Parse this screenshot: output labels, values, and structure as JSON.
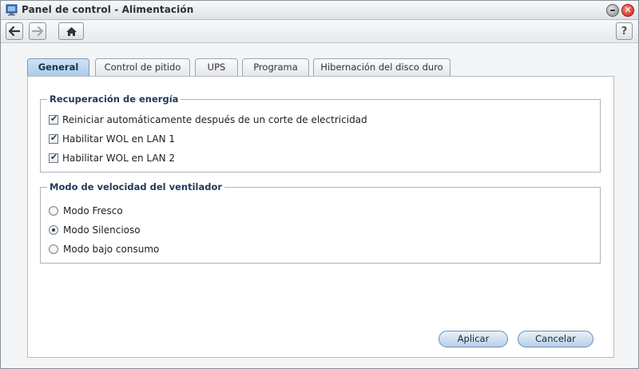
{
  "window": {
    "title": "Panel de control - Alimentación",
    "close_glyph": "✕"
  },
  "toolbar": {
    "back_icon": "arrow-left-icon",
    "forward_icon": "arrow-right-icon",
    "home_icon": "home-icon",
    "help_label": "?"
  },
  "tabs": [
    {
      "label": "General",
      "active": true
    },
    {
      "label": "Control de pitido",
      "active": false
    },
    {
      "label": "UPS",
      "active": false
    },
    {
      "label": "Programa",
      "active": false
    },
    {
      "label": "Hibernación del disco duro",
      "active": false
    }
  ],
  "power_recovery": {
    "legend": "Recuperación de energía",
    "options": [
      {
        "label": "Reiniciar automáticamente después de un corte de electricidad",
        "checked": true
      },
      {
        "label": "Habilitar WOL en LAN 1",
        "checked": true
      },
      {
        "label": "Habilitar WOL en LAN 2",
        "checked": true
      }
    ]
  },
  "fan_mode": {
    "legend": "Modo de velocidad del ventilador",
    "options": [
      {
        "label": "Modo Fresco",
        "selected": false
      },
      {
        "label": "Modo Silencioso",
        "selected": true
      },
      {
        "label": "Modo bajo consumo",
        "selected": false
      }
    ]
  },
  "actions": {
    "apply_label": "Aplicar",
    "cancel_label": "Cancelar"
  },
  "colors": {
    "active_tab": "#a9c9e8",
    "legend_text": "#1e3a5a",
    "button_blue": "#b8cfe8"
  }
}
